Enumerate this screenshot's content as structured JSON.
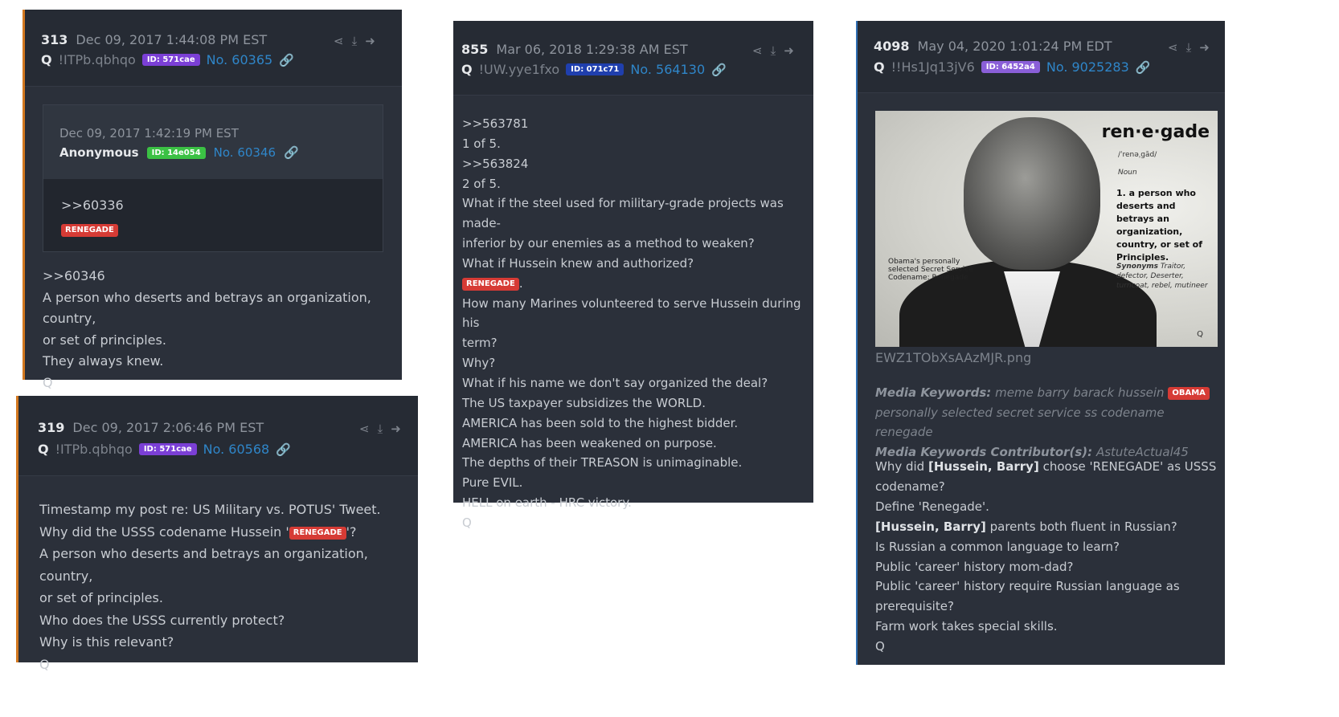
{
  "posts": {
    "p313": {
      "num": "313",
      "date": "Dec 09, 2017 1:44:08 PM EST",
      "author": "Q",
      "trip": "!ITPb.qbhqo",
      "id": "ID: 571cae",
      "no": "No. 60365",
      "quote": {
        "date": "Dec 09, 2017 1:42:19 PM EST",
        "author": "Anonymous",
        "id": "ID: 14e054",
        "no": "No. 60346",
        "ref": ">>60336",
        "tag": "RENEGADE"
      },
      "lines": [
        ">>60346",
        "A person who deserts and betrays an organization, country,",
        "or set of principles.",
        "They always knew.",
        "Q"
      ]
    },
    "p319": {
      "num": "319",
      "date": "Dec 09, 2017 2:06:46 PM EST",
      "author": "Q",
      "trip": "!ITPb.qbhqo",
      "id": "ID: 571cae",
      "no": "No. 60568",
      "line1": "Timestamp my post re: US Military vs. POTUS' Tweet.",
      "line2_pre": "Why did the USSS codename Hussein '",
      "line2_tag": "RENEGADE",
      "line2_post": "'?",
      "lines_rest": [
        "A person who deserts and betrays an organization, country,",
        "or set of principles.",
        "Who does the USSS currently protect?",
        "Why is this relevant?",
        "Q"
      ]
    },
    "p855": {
      "num": "855",
      "date": "Mar 06, 2018 1:29:38 AM EST",
      "author": "Q",
      "trip": "!UW.yye1fxo",
      "id": "ID: 071c71",
      "no": "No. 564130",
      "lines_a": [
        ">>563781",
        "1 of 5.",
        ">>563824",
        "2 of 5.",
        "What if the steel used for military-grade projects was made-",
        "inferior by our enemies as a method to weaken?",
        "What if Hussein knew and authorized?"
      ],
      "tag": "RENEGADE",
      "tag_after": ".",
      "lines_b": [
        "How many Marines volunteered to serve Hussein during his",
        "term?",
        "Why?",
        "What if his name we don't say organized the deal?",
        "The US taxpayer subsidizes the WORLD.",
        "AMERICA has been sold to the highest bidder.",
        "AMERICA has been weakened on purpose.",
        "The depths of their TREASON is unimaginable.",
        "Pure EVIL.",
        "HELL on earth - HRC victory.",
        "Q"
      ]
    },
    "p4098": {
      "num": "4098",
      "date": "May 04, 2020 1:01:24 PM EDT",
      "author": "Q",
      "trip": "!!Hs1Jq13jV6",
      "id": "ID: 6452a4",
      "no": "No. 9025283",
      "image": {
        "title": "ren·e·gade",
        "pron": "/ˈrenəˌɡād/",
        "pos": "Noun",
        "definition": "1. a person who deserts and betrays an organization, country, or set of Principles.",
        "synonyms_label": "Synonyms",
        "synonyms": "Traitor, defector, Deserter, turncoat, rebel, mutineer",
        "caption": "Obama's personally selected Secret Service Codename: Renegade",
        "q": "Q"
      },
      "filename": "EWZ1TObXsAAzMJR.png",
      "mk_label": "Media Keywords:",
      "mk_text": "meme barry barack hussein",
      "mk_tag": "OBAMA",
      "mk_text2": "personally selected secret service ss codename renegade",
      "mkc_label": "Media Keywords Contributor(s):",
      "mkc_value": "AstuteActual45",
      "l1_pre": "Why did ",
      "l1_bold": "[Hussein, Barry]",
      "l1_post": " choose 'RENEGADE' as USSS",
      "l2": "codename?",
      "l3": "Define 'Renegade'.",
      "l4_bold": "[Hussein, Barry]",
      "l4_post": " parents both fluent in Russian?",
      "rest": [
        "Is Russian a common language to learn?",
        "Public 'career' history mom-dad?",
        "Public 'career' history require Russian language as",
        "prerequisite?",
        "Farm work takes special skills.",
        "Q"
      ]
    }
  },
  "icons": {
    "share": "share-icon",
    "download": "download-icon",
    "goto": "goto-icon",
    "link": "link-icon"
  },
  "colors": {
    "card_bg": "#2b303a",
    "accent_border": "#d3781f",
    "tag_red": "#d63b35",
    "id_purple": "#7b3fd6",
    "id_green": "#3bc144",
    "id_navy": "#1f3fae",
    "link_blue": "#2f86c9"
  }
}
